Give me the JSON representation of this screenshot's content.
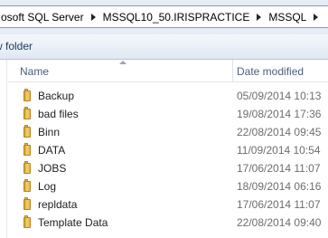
{
  "breadcrumb": {
    "items": [
      {
        "label": "osoft SQL Server"
      },
      {
        "label": "MSSQL10_50.IRISPRACTICE"
      },
      {
        "label": "MSSQL"
      }
    ]
  },
  "toolbar": {
    "new_folder_label": "w folder"
  },
  "columns": {
    "name": "Name",
    "date_modified": "Date modified"
  },
  "files": [
    {
      "name": "Backup",
      "date": "05/09/2014 10:13",
      "icon": "folder-icon"
    },
    {
      "name": "bad files",
      "date": "19/08/2014 17:36",
      "icon": "folder-icon"
    },
    {
      "name": "Binn",
      "date": "22/08/2014 09:45",
      "icon": "folder-icon"
    },
    {
      "name": "DATA",
      "date": "11/09/2014 10:54",
      "icon": "folder-icon"
    },
    {
      "name": "JOBS",
      "date": "17/06/2014 11:07",
      "icon": "folder-icon"
    },
    {
      "name": "Log",
      "date": "18/09/2014 06:16",
      "icon": "folder-icon"
    },
    {
      "name": "repldata",
      "date": "17/06/2014 11:07",
      "icon": "folder-icon"
    },
    {
      "name": "Template Data",
      "date": "22/08/2014 09:40",
      "icon": "folder-icon"
    }
  ],
  "colors": {
    "address_bar_bg": "#e6edf6",
    "toolbar_text": "#1e395b",
    "header_text": "#4c607a",
    "date_text": "#6d6d6d",
    "folder_yellow": "#f3cf6a"
  }
}
